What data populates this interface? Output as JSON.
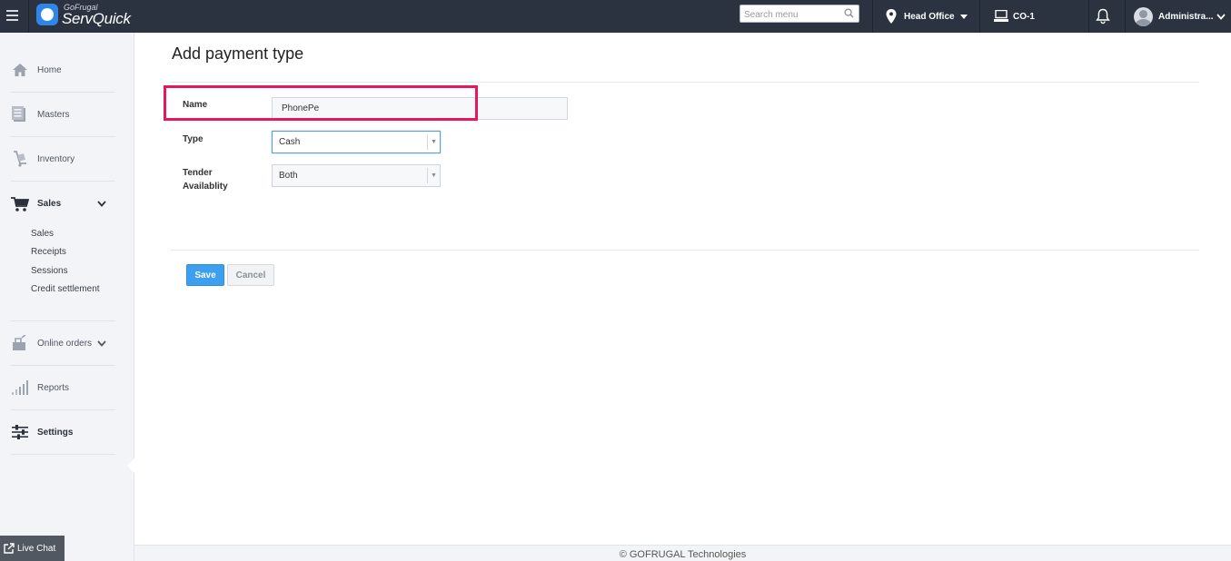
{
  "header": {
    "menu_icon": "hamburger-icon",
    "logo_small": "GoFrugal",
    "logo_main": "ServQuick",
    "search_placeholder": "Search menu",
    "location": "Head Office",
    "terminal": "CO-1",
    "user": "Administra..."
  },
  "sidebar": {
    "items": [
      {
        "label": "Home",
        "icon": "home-icon"
      },
      {
        "label": "Masters",
        "icon": "masters-icon"
      },
      {
        "label": "Inventory",
        "icon": "inventory-icon"
      },
      {
        "label": "Sales",
        "icon": "cart-icon"
      },
      {
        "label": "Online orders",
        "icon": "online-orders-icon"
      },
      {
        "label": "Reports",
        "icon": "reports-icon"
      },
      {
        "label": "Settings",
        "icon": "settings-icon"
      }
    ],
    "sales_sub": [
      "Sales",
      "Receipts",
      "Sessions",
      "Credit settlement"
    ],
    "live_chat": "Live Chat"
  },
  "form": {
    "title": "Add payment type",
    "name_label": "Name",
    "name_value": "PhonePe",
    "type_label": "Type",
    "type_value": "Cash",
    "tender_label_1": "Tender",
    "tender_label_2": "Availablity",
    "tender_value": "Both",
    "save_label": "Save",
    "cancel_label": "Cancel"
  },
  "colors": {
    "topbar": "#2c3340",
    "accent": "#3c9ff0",
    "highlight": "#e8175d"
  },
  "footer": {
    "text": "© GOFRUGAL Technologies"
  }
}
